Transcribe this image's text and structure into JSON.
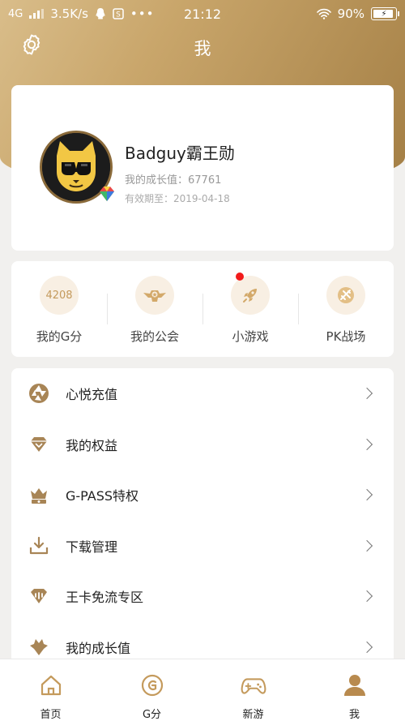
{
  "status_bar": {
    "network": "4G",
    "speed": "3.5K/s",
    "time": "21:12",
    "battery": "90%"
  },
  "header": {
    "title": "我"
  },
  "profile": {
    "username": "Badguy霸王勋",
    "growth_label": "我的成长值：67761",
    "expiry_label": "有效期至：2019-04-18"
  },
  "quick_actions": [
    {
      "label": "我的G分",
      "value": "4208",
      "icon": "points-icon"
    },
    {
      "label": "我的公会",
      "icon": "guild-emblem-icon"
    },
    {
      "label": "小游戏",
      "icon": "rocket-icon",
      "has_notification": true
    },
    {
      "label": "PK战场",
      "icon": "pk-icon"
    }
  ],
  "menu": [
    {
      "label": "心悦充值",
      "icon": "aperture-icon"
    },
    {
      "label": "我的权益",
      "icon": "diamond-icon"
    },
    {
      "label": "G-PASS特权",
      "icon": "crown-icon"
    },
    {
      "label": "下载管理",
      "icon": "download-icon"
    },
    {
      "label": "王卡免流专区",
      "icon": "card-icon"
    },
    {
      "label": "我的成长值",
      "icon": "growth-icon"
    }
  ],
  "tabs": [
    {
      "label": "首页",
      "icon": "home-icon"
    },
    {
      "label": "G分",
      "icon": "g-coin-icon"
    },
    {
      "label": "新游",
      "icon": "gamepad-icon"
    },
    {
      "label": "我",
      "icon": "person-icon",
      "active": true
    }
  ],
  "colors": {
    "accent": "#c49a5c",
    "header_gradient_start": "#d9bd8a",
    "header_gradient_end": "#a47f45",
    "notification": "#f21b1b"
  }
}
